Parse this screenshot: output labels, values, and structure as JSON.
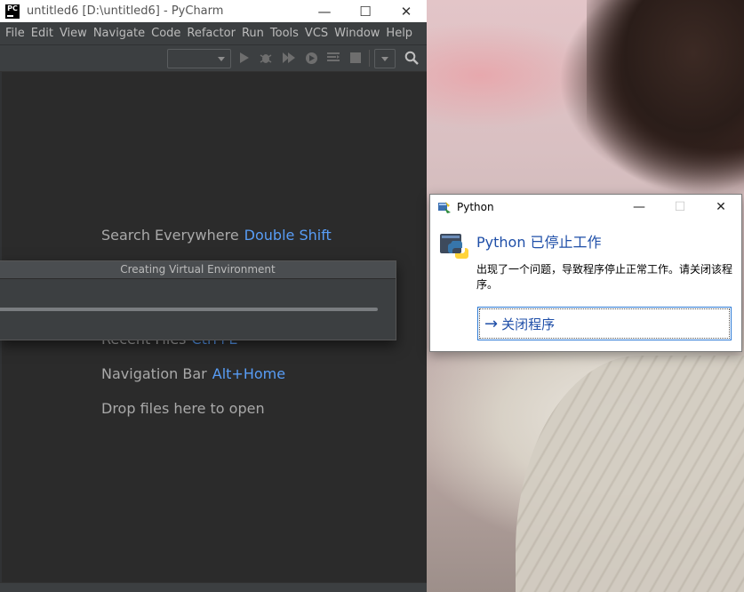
{
  "pycharm": {
    "title": "untitled6 [D:\\untitled6] - PyCharm",
    "logo_text": "PC",
    "window_buttons": [
      "—",
      "☐",
      "✕"
    ],
    "menu": [
      "File",
      "Edit",
      "View",
      "Navigate",
      "Code",
      "Refactor",
      "Run",
      "Tools",
      "VCS",
      "Window",
      "Help"
    ],
    "welcome_hints": [
      {
        "text": "Search Everywhere",
        "key": "Double Shift"
      },
      {
        "text": "Recent Files",
        "key": "Ctrl+E"
      },
      {
        "text": "Navigation Bar",
        "key": "Alt+Home"
      },
      {
        "text": "Drop files here to open",
        "key": ""
      }
    ]
  },
  "venv_dialog": {
    "title": "Creating Virtual Environment",
    "progress": 1.0
  },
  "python_dialog": {
    "title": "Python",
    "heading": "Python 已停止工作",
    "message": "出现了一个问题，导致程序停止正常工作。请关闭该程序。",
    "close_button": "关闭程序",
    "window_buttons": [
      "—",
      "☐",
      "✕"
    ]
  },
  "colors": {
    "accent_blue": "#589df6",
    "dialog_heading": "#1f4fa8",
    "ide_bg": "#2b2b2b"
  }
}
